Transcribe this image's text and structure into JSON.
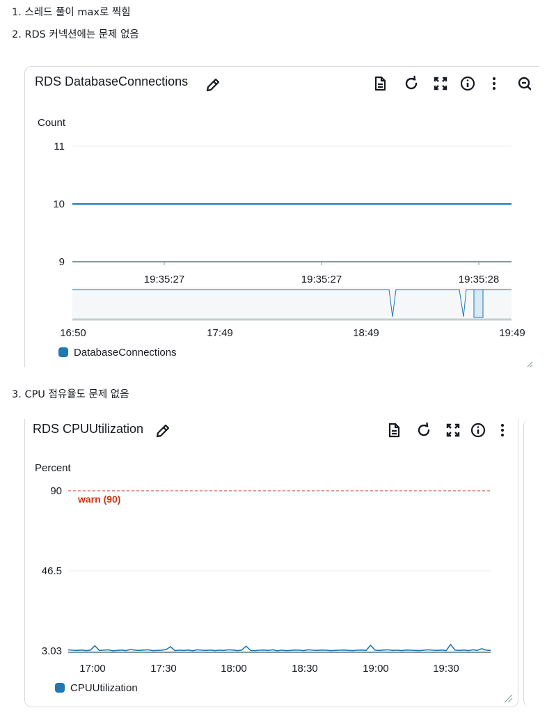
{
  "notes": {
    "line1": "1. 스레드 풀이 max로 찍힘",
    "line2": "2. RDS 커넥션에는 문제 없음",
    "line3": "3. CPU 점유율도 문제 없음"
  },
  "colors": {
    "series": "#1f77b4",
    "threshold": "#d13212",
    "grid": "#e9ebed",
    "axis": "#879596"
  },
  "panel1": {
    "title": "RDS DatabaseConnections",
    "icons": [
      "edit-icon",
      "document-icon",
      "refresh-icon",
      "expand-icon",
      "info-icon",
      "more-icon",
      "zoom-out-icon"
    ]
  },
  "panel2": {
    "title": "RDS CPUUtilization",
    "icons": [
      "edit-icon",
      "document-icon",
      "refresh-icon",
      "expand-icon",
      "info-icon",
      "more-icon"
    ]
  },
  "chart_data": [
    {
      "type": "line",
      "ylabel": "Count",
      "ylim": [
        9,
        11
      ],
      "yticks": [
        "11",
        "10",
        "9"
      ],
      "series": [
        {
          "name": "DatabaseConnections",
          "x": [
            "19:35:27",
            "19:35:28"
          ],
          "values": [
            10,
            10
          ]
        }
      ],
      "xticks": [
        "19:35:27",
        "19:35:27",
        "19:35:28"
      ],
      "navigator": {
        "xticks": [
          "16:50",
          "17:49",
          "18:49",
          "19:49"
        ],
        "dips_at": [
          "19:01",
          "19:30",
          "19:36"
        ]
      },
      "grid": true,
      "legend": "bottom-left"
    },
    {
      "type": "line",
      "ylabel": "Percent",
      "ylim": [
        3.03,
        90
      ],
      "yticks": [
        "90",
        "46.5",
        "3.03"
      ],
      "threshold": {
        "label": "warn (90)",
        "value": 90
      },
      "xticks": [
        "17:00",
        "17:30",
        "18:00",
        "18:30",
        "19:00",
        "19:30"
      ],
      "series": [
        {
          "name": "CPUUtilization",
          "values": [
            3.6,
            3.4,
            3.3,
            3.5,
            3.2,
            3.4,
            5.8,
            3.3,
            3.4,
            3.6,
            3.1,
            3.3,
            3.5,
            3.2,
            3.8,
            3.4,
            3.3,
            3.5,
            3.6,
            3.2,
            3.3,
            3.4,
            3.7,
            5.3,
            3.2,
            3.4,
            3.3,
            3.5,
            3.1,
            3.6,
            3.4,
            3.3,
            3.5,
            3.2,
            3.4,
            3.3,
            3.6,
            3.5,
            3.2,
            3.4,
            5.6,
            3.3,
            3.2,
            3.4,
            3.5,
            3.3,
            3.6,
            3.1,
            3.4,
            3.2,
            3.3,
            3.5,
            3.4,
            3.2,
            3.6,
            3.4,
            3.3,
            3.5,
            3.4,
            3.2,
            3.3,
            3.4,
            3.5,
            3.3,
            3.2,
            3.4,
            3.5,
            3.3,
            6.1,
            3.4,
            3.3,
            3.5,
            3.6,
            3.3,
            3.4,
            3.2,
            3.5,
            3.4,
            3.3,
            3.2,
            3.4,
            3.6,
            3.4,
            3.3,
            3.5,
            3.2,
            6.5,
            3.4,
            3.3,
            3.5,
            3.2,
            3.6,
            3.3,
            4.2,
            3.4,
            3.3
          ]
        }
      ],
      "grid": true,
      "legend": "bottom-left"
    }
  ]
}
